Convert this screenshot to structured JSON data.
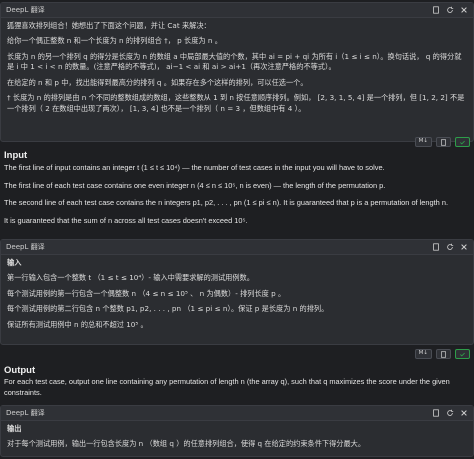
{
  "icons": {
    "copy": "copy-icon",
    "refresh": "refresh-icon",
    "close": "close-icon",
    "translate": "md-icon",
    "check": "check-icon"
  },
  "panel1": {
    "title": "DeepL 翻译",
    "p1": "狐狸喜欢排列组合！她想出了下面这个问题，并让 Cat 来解决：",
    "p2": "给你一个偶正整数 n 和一个长度为 n 的排列组合 †， p 长度为 n 。",
    "p3": "长度为 n 的另一个排列 q 的得分是长度为 n 的数组 a 中局部最大值的个数，其中 ai = pi + qi 为所有 i（1 ≤ i ≤ n）。换句话说， q 的得分就是 i 中 1 < i < n 的数量。(注意严格的不等式)， ai−1 < ai 和 ai > ai+1（再次注意严格的不等式）。",
    "p4": "在给定的 n 和 p 中，找出能得到最高分的排列 q 。如果存在多个这样的排列，可以任选一个。",
    "p5": "† 长度为 n 的排列是由 n 个不同的整数组成的数组，这些整数从 1 到 n 按任意顺序排列。例如， [2, 3, 1, 5, 4] 是一个排列，但 [1, 2, 2] 不是一个排列（ 2 在数组中出现了两次）， [1, 3, 4] 也不是一个排列（ n = 3 ，但数组中有 4 ）。"
  },
  "input": {
    "title": "Input",
    "p1": "The first line of input contains an integer t (1 ≤ t ≤ 10⁴) — the number of test cases in the input you will have to solve.",
    "p2": "The first line of each test case contains one even integer n (4 ≤ n ≤ 10⁵, n is even) — the length of the permutation p.",
    "p3": "The second line of each test case contains the n integers p1, p2, . . . , pn (1 ≤ pi ≤ n). It is guaranteed that p is a permutation of length n.",
    "p4": "It is guaranteed that the sum of n across all test cases doesn't exceed 10⁵."
  },
  "panel2": {
    "title": "DeepL 翻译",
    "heading": "输入",
    "p1": "第一行输入包含一个整数 t （1 ≤ t ≤ 10⁴）- 输入中需要求解的测试用例数。",
    "p2": "每个测试用例的第一行包含一个偶整数 n （4 ≤ n ≤ 10⁵ 、 n 为偶数）- 排列长度 p 。",
    "p3": "每个测试用例的第二行包含 n 个整数 p1, p2, . . . , pn （1 ≤ pi ≤ n）。保证 p 是长度为 n 的排列。",
    "p4": "保证所有测试用例中 n 的总和不超过 10⁵ 。"
  },
  "output": {
    "title": "Output",
    "p1": "For each test case, output one line containing any permutation of length n (the array q), such that q maximizes the score under the given constraints."
  },
  "panel3": {
    "title": "DeepL 翻译",
    "heading": "输出",
    "p1": "对于每个测试用例，输出一行包含长度为 n （数组 q ）的任意排列组合，使得 q 在给定的约束条件下得分最大。"
  },
  "toolbar": {
    "md_label": "M↓"
  }
}
